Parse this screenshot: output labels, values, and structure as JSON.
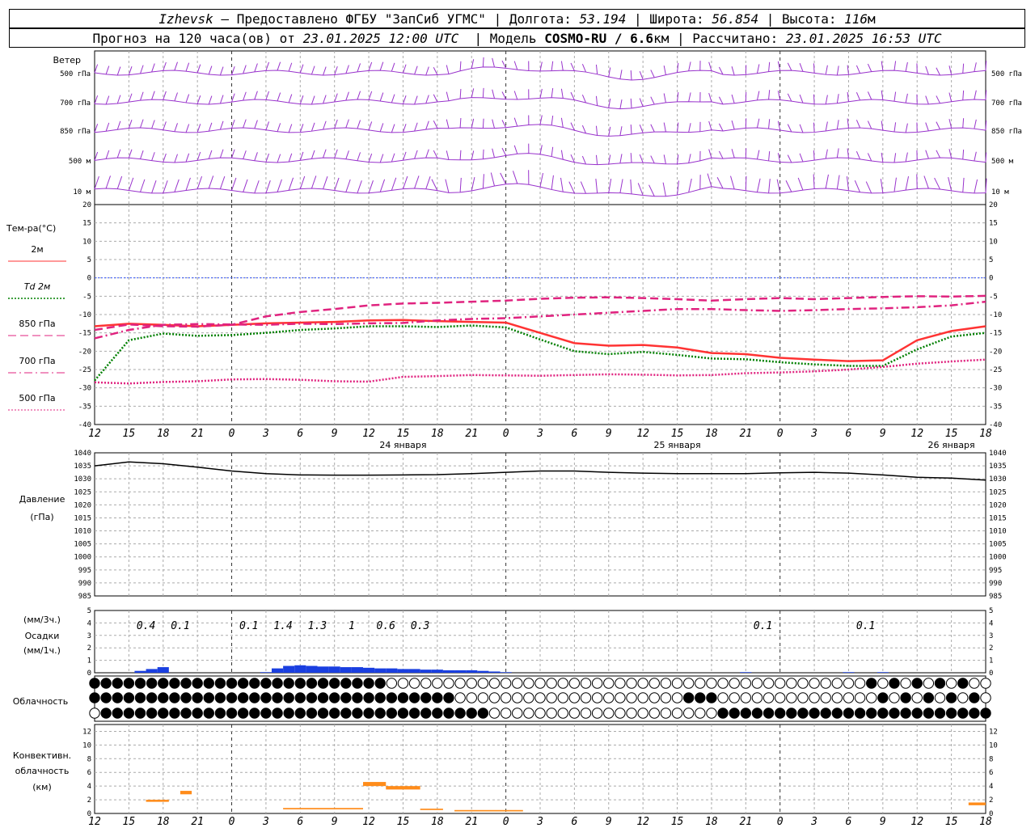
{
  "header": {
    "line1": {
      "city": "Izhevsk",
      "provider": "— Предоставлено ФГБУ \"ЗапСиб УГМС\"",
      "lon_label": "Долгота:",
      "lon": "53.194",
      "lat_label": "Широта:",
      "lat": "56.854",
      "alt_label": "Высота:",
      "alt": "116",
      "alt_unit": "м"
    },
    "line2": {
      "forecast_label": "Прогноз на 120 часа(ов) от",
      "forecast_time": "23.01.2025 12:00 UTC",
      "model_label": "Модель",
      "model": "COSMO-RU / 6.6",
      "model_unit": "км",
      "calc_label": "Рассчитано:",
      "calc_time": "23.01.2025 16:53 UTC"
    }
  },
  "colors": {
    "wind": "#9933cc",
    "t2m": "#ff3333",
    "td2m": "#008000",
    "t850": "#e0237f",
    "t700": "#e0237f",
    "t500": "#e0237f",
    "zero_line": "#3355ff",
    "pressure": "#000000",
    "precip": "#1a3fe0",
    "convective": "#ff8c1a"
  },
  "chart_data": [
    {
      "type": "line",
      "panel": "wind",
      "title": "Ветер",
      "levels": [
        "500 гПа",
        "700 гПа",
        "850 гПа",
        "500 м",
        "10 м"
      ],
      "note": "wind barbs by level every hour"
    },
    {
      "type": "line",
      "panel": "temperature",
      "title": "Тем-ра(°C)",
      "ylim": [
        -40,
        20
      ],
      "yticks": [
        20,
        15,
        10,
        5,
        0,
        -5,
        -10,
        -15,
        -20,
        -25,
        -30,
        -35,
        -40
      ],
      "x": [
        0,
        3,
        6,
        9,
        12,
        15,
        18,
        21,
        24,
        27,
        30,
        33,
        36,
        39,
        42,
        45,
        48,
        51,
        54,
        57,
        60,
        63,
        66,
        69,
        72,
        75,
        78
      ],
      "series": [
        {
          "name": "2м",
          "style": "solid",
          "values": [
            -13.2,
            -12.5,
            -12.8,
            -13.2,
            -12.8,
            -12.4,
            -12.2,
            -12.0,
            -11.6,
            -11.5,
            -11.8,
            -12.0,
            -12.2,
            -15.0,
            -17.8,
            -18.5,
            -18.3,
            -19.0,
            -20.5,
            -20.8,
            -21.8,
            -22.3,
            -22.7,
            -22.5,
            -17.0,
            -14.5,
            -13.2
          ]
        },
        {
          "name": "Td 2м",
          "style": "dotted",
          "values": [
            -28.0,
            -17.0,
            -15.2,
            -15.8,
            -15.6,
            -15.0,
            -14.2,
            -13.8,
            -13.2,
            -13.2,
            -13.4,
            -13.0,
            -13.5,
            -16.8,
            -20.0,
            -20.8,
            -20.2,
            -21.0,
            -22.0,
            -22.2,
            -23.0,
            -23.6,
            -24.0,
            -24.0,
            -19.5,
            -16.0,
            -15.0
          ]
        },
        {
          "name": "850 гПа",
          "style": "dashed",
          "values": [
            -14.2,
            -12.7,
            -13.2,
            -13.3,
            -12.8,
            -10.5,
            -9.3,
            -8.5,
            -7.5,
            -7.0,
            -6.8,
            -6.5,
            -6.2,
            -5.7,
            -5.4,
            -5.3,
            -5.5,
            -5.8,
            -6.2,
            -5.8,
            -5.5,
            -5.8,
            -5.5,
            -5.2,
            -5.0,
            -5.1,
            -4.9
          ]
        },
        {
          "name": "700 гПа",
          "style": "dashdot",
          "values": [
            -16.5,
            -14.2,
            -12.8,
            -12.6,
            -12.7,
            -12.8,
            -12.5,
            -12.6,
            -12.4,
            -12.3,
            -11.6,
            -11.2,
            -11.0,
            -10.5,
            -10.0,
            -9.5,
            -9.0,
            -8.5,
            -8.5,
            -8.8,
            -9.0,
            -8.8,
            -8.5,
            -8.3,
            -8.0,
            -7.5,
            -6.5
          ]
        },
        {
          "name": "500 гПа",
          "style": "dotted",
          "values": [
            -28.5,
            -28.8,
            -28.4,
            -28.2,
            -27.7,
            -27.6,
            -27.8,
            -28.2,
            -28.3,
            -27.0,
            -26.8,
            -26.5,
            -26.6,
            -26.7,
            -26.5,
            -26.3,
            -26.4,
            -26.6,
            -26.5,
            -26.0,
            -25.8,
            -25.5,
            -25.0,
            -24.3,
            -23.4,
            -22.8,
            -22.3
          ]
        }
      ]
    },
    {
      "type": "line",
      "panel": "pressure",
      "ylabel": "Давление",
      "yunit": "(гПа)",
      "ylim": [
        985,
        1040
      ],
      "yticks": [
        1040,
        1035,
        1030,
        1025,
        1020,
        1015,
        1010,
        1005,
        1000,
        995,
        990,
        985
      ],
      "x": [
        0,
        3,
        6,
        9,
        12,
        15,
        18,
        21,
        24,
        27,
        30,
        33,
        36,
        39,
        42,
        45,
        48,
        51,
        54,
        57,
        60,
        63,
        66,
        69,
        72,
        75,
        78
      ],
      "series": [
        {
          "name": "",
          "values": [
            1035,
            1036.5,
            1035.8,
            1034.5,
            1033,
            1032,
            1031.5,
            1031.4,
            1031.4,
            1031.5,
            1031.6,
            1032,
            1032.5,
            1033,
            1033,
            1032.5,
            1032.2,
            1032,
            1032,
            1032,
            1032.3,
            1032.5,
            1032.2,
            1031.5,
            1030.6,
            1030.3,
            1029.5
          ]
        }
      ]
    },
    {
      "type": "bar",
      "panel": "precipitation",
      "ylabel": "Осадки",
      "yunit_top": "(мм/3ч.)",
      "yunit_bottom": "(мм/1ч.)",
      "ylim": [
        0,
        5
      ],
      "yticks": [
        5,
        4,
        3,
        2,
        1,
        0
      ],
      "x": [
        4,
        5,
        6,
        15,
        16,
        17,
        18,
        19,
        20,
        21,
        22,
        23,
        24,
        25,
        26,
        27,
        28,
        29,
        30,
        31,
        32,
        33,
        34,
        35,
        36,
        57,
        66,
        69
      ],
      "values": [
        0.15,
        0.3,
        0.45,
        0.05,
        0.35,
        0.55,
        0.6,
        0.55,
        0.5,
        0.5,
        0.45,
        0.45,
        0.4,
        0.35,
        0.35,
        0.3,
        0.3,
        0.25,
        0.25,
        0.2,
        0.2,
        0.2,
        0.15,
        0.1,
        0.05,
        0.05,
        0.05,
        0.05
      ],
      "totals": [
        {
          "x": 4.5,
          "label": "0.4"
        },
        {
          "x": 7.5,
          "label": "0.1"
        },
        {
          "x": 13.5,
          "label": "0.1"
        },
        {
          "x": 16.5,
          "label": "1.4"
        },
        {
          "x": 19.5,
          "label": "1.3"
        },
        {
          "x": 22.5,
          "label": "1"
        },
        {
          "x": 25.5,
          "label": "0.6"
        },
        {
          "x": 28.5,
          "label": "0.3"
        },
        {
          "x": 58.5,
          "label": "0.1"
        },
        {
          "x": 67.5,
          "label": "0.1"
        }
      ]
    },
    {
      "type": "table",
      "panel": "cloudiness",
      "ylabel": "Облачность",
      "note": "three rows of cloud-cover symbols for each hour (upper / middle / lower)"
    },
    {
      "type": "bar",
      "panel": "convective",
      "ylabel": "Конвективн. облачность (км)",
      "ylim": [
        0,
        13
      ],
      "yticks": [
        12,
        10,
        8,
        6,
        4,
        2,
        0
      ],
      "segments": [
        {
          "from": 4.5,
          "to": 6.5,
          "bottom": 1.7,
          "top": 2.0
        },
        {
          "from": 7.5,
          "to": 8.5,
          "bottom": 2.8,
          "top": 3.3
        },
        {
          "from": 16.5,
          "to": 23.5,
          "bottom": 0.6,
          "top": 0.8
        },
        {
          "from": 23.5,
          "to": 25.5,
          "bottom": 4.0,
          "top": 4.6
        },
        {
          "from": 25.5,
          "to": 28.5,
          "bottom": 3.5,
          "top": 4.0
        },
        {
          "from": 28.5,
          "to": 30.5,
          "bottom": 0.5,
          "top": 0.7
        },
        {
          "from": 31.5,
          "to": 37.5,
          "bottom": 0.3,
          "top": 0.5
        },
        {
          "from": 76.5,
          "to": 78,
          "bottom": 1.2,
          "top": 1.6
        }
      ]
    }
  ],
  "xaxis": {
    "ticks": [
      0,
      3,
      6,
      9,
      12,
      15,
      18,
      21,
      24,
      27,
      30,
      33,
      36,
      39,
      42,
      45,
      48,
      51,
      54,
      57,
      60,
      63,
      66,
      69,
      72,
      75,
      78
    ],
    "labels": [
      "12",
      "15",
      "18",
      "21",
      "0",
      "3",
      "6",
      "9",
      "12",
      "15",
      "18",
      "21",
      "0",
      "3",
      "6",
      "9",
      "12",
      "15",
      "18",
      "21",
      "0",
      "3",
      "6",
      "9",
      "12",
      "15",
      "18"
    ],
    "days": [
      {
        "x": 27,
        "label": "24 января"
      },
      {
        "x": 51,
        "label": "25 января"
      },
      {
        "x": 75,
        "label": "26 января"
      }
    ]
  }
}
